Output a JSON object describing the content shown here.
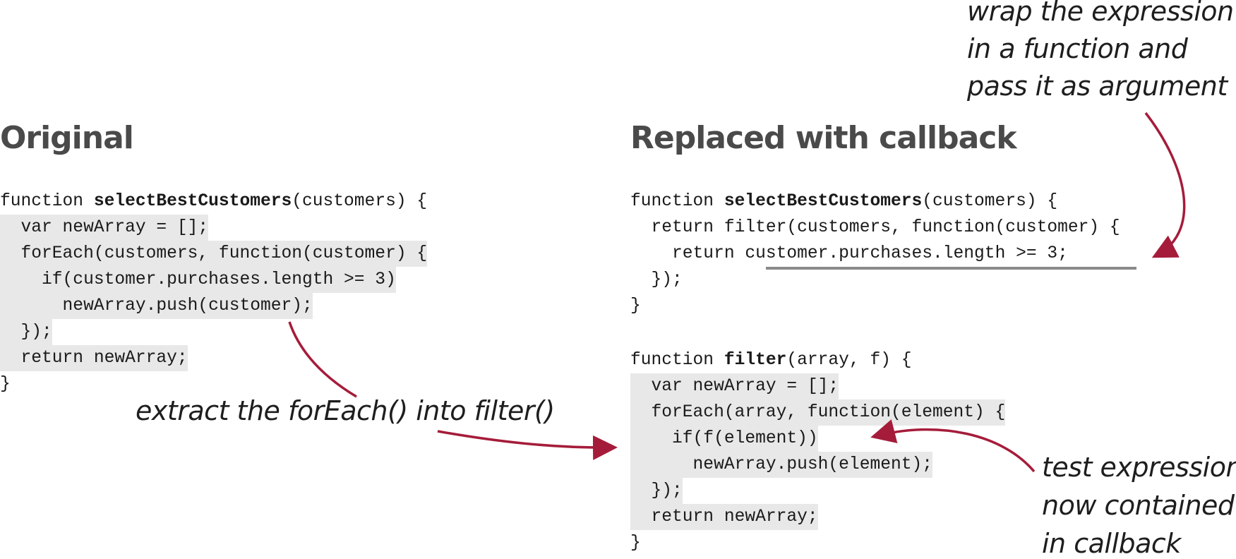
{
  "original": {
    "heading": "Original",
    "lines": [
      "function ",
      "selectBestCustomers",
      "(customers) {",
      "  var newArray = [];",
      "  forEach(customers, function(customer) {",
      "    if(customer.purchases.length >= 3)",
      "      newArray.push(customer);",
      "  });",
      "  return newArray;",
      "}"
    ]
  },
  "replaced": {
    "heading": "Replaced with callback",
    "fn1_pre": "function ",
    "fn1_name": "selectBestCustomers",
    "fn1_post": "(customers) {",
    "fn1_line2": "  return filter(customers, function(customer) {",
    "fn1_line3_pre": "    return ",
    "fn1_line3_expr": "customer.purchases.length >= 3",
    "fn1_line3_post": ";",
    "fn1_line4": "  });",
    "fn1_line5": "}",
    "fn2_pre": "function ",
    "fn2_name": "filter",
    "fn2_post": "(array, f) {",
    "fn2_line2": "  var newArray = [];",
    "fn2_line3": "  forEach(array, function(element) {",
    "fn2_line4": "    if(f(element))",
    "fn2_line5": "      newArray.push(element);",
    "fn2_line6": "  });",
    "fn2_line7": "  return newArray;",
    "fn2_line8": "}"
  },
  "annotations": {
    "wrap": [
      "wrap the expression",
      "in a function and",
      "pass it as argument"
    ],
    "extract": "extract the forEach() into filter()",
    "test": [
      "test expression",
      "now contained",
      "in callback"
    ]
  },
  "colors": {
    "arrow": "#a51c3a",
    "highlight": "#e8e8e8",
    "heading": "#4a4a4a"
  }
}
